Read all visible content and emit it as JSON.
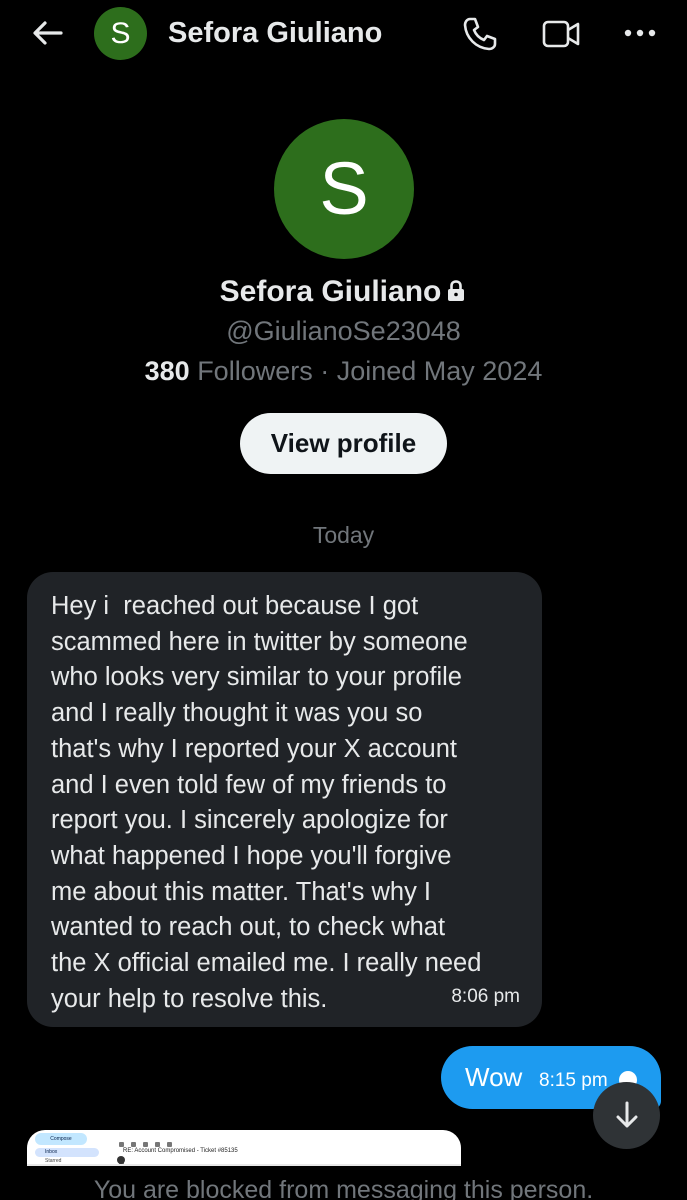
{
  "header": {
    "back_icon": "arrow-left-icon",
    "avatar_letter": "S",
    "name": "Sefora Giuliano",
    "call_icon": "phone-icon",
    "video_icon": "video-camera-icon",
    "more_icon": "more-horizontal-icon"
  },
  "profile": {
    "avatar_letter": "S",
    "name": "Sefora Giuliano",
    "lock_icon": "lock-icon",
    "handle": "@GiulianoSe23048",
    "followers_count": "380",
    "followers_label": " Followers · Joined May 2024",
    "view_profile_label": "View profile"
  },
  "conversation": {
    "date_separator": "Today",
    "received_message": {
      "text": "Hey i  reached out because I got\nscammed here in twitter by someone\nwho looks very similar to your profile\nand I really thought it was you so\nthat's why I reported your X account\nand I even told few of my friends to\nreport you. I sincerely apologize for\nwhat happened I hope you'll forgive\nme about this matter. That's why I\nwanted to reach out, to check what\nthe X official emailed me. I really need\nyour help to resolve this.",
      "time": "8:06 pm"
    },
    "sent_message": {
      "text": "Wow",
      "time": "8:15 pm"
    },
    "scroll_down_icon": "arrow-down-icon",
    "attachment": {
      "compose": "Compose",
      "inbox": "Inbox",
      "starred": "Starred",
      "subject": "RE: Account Compromised - Ticket #85135"
    },
    "blocked_notice": "You are blocked from messaging this person."
  },
  "colors": {
    "background": "#000000",
    "avatar_green": "#2d6e1c",
    "bubble_received": "#202327",
    "bubble_sent": "#1d9bf0",
    "muted_text": "#71767b"
  }
}
